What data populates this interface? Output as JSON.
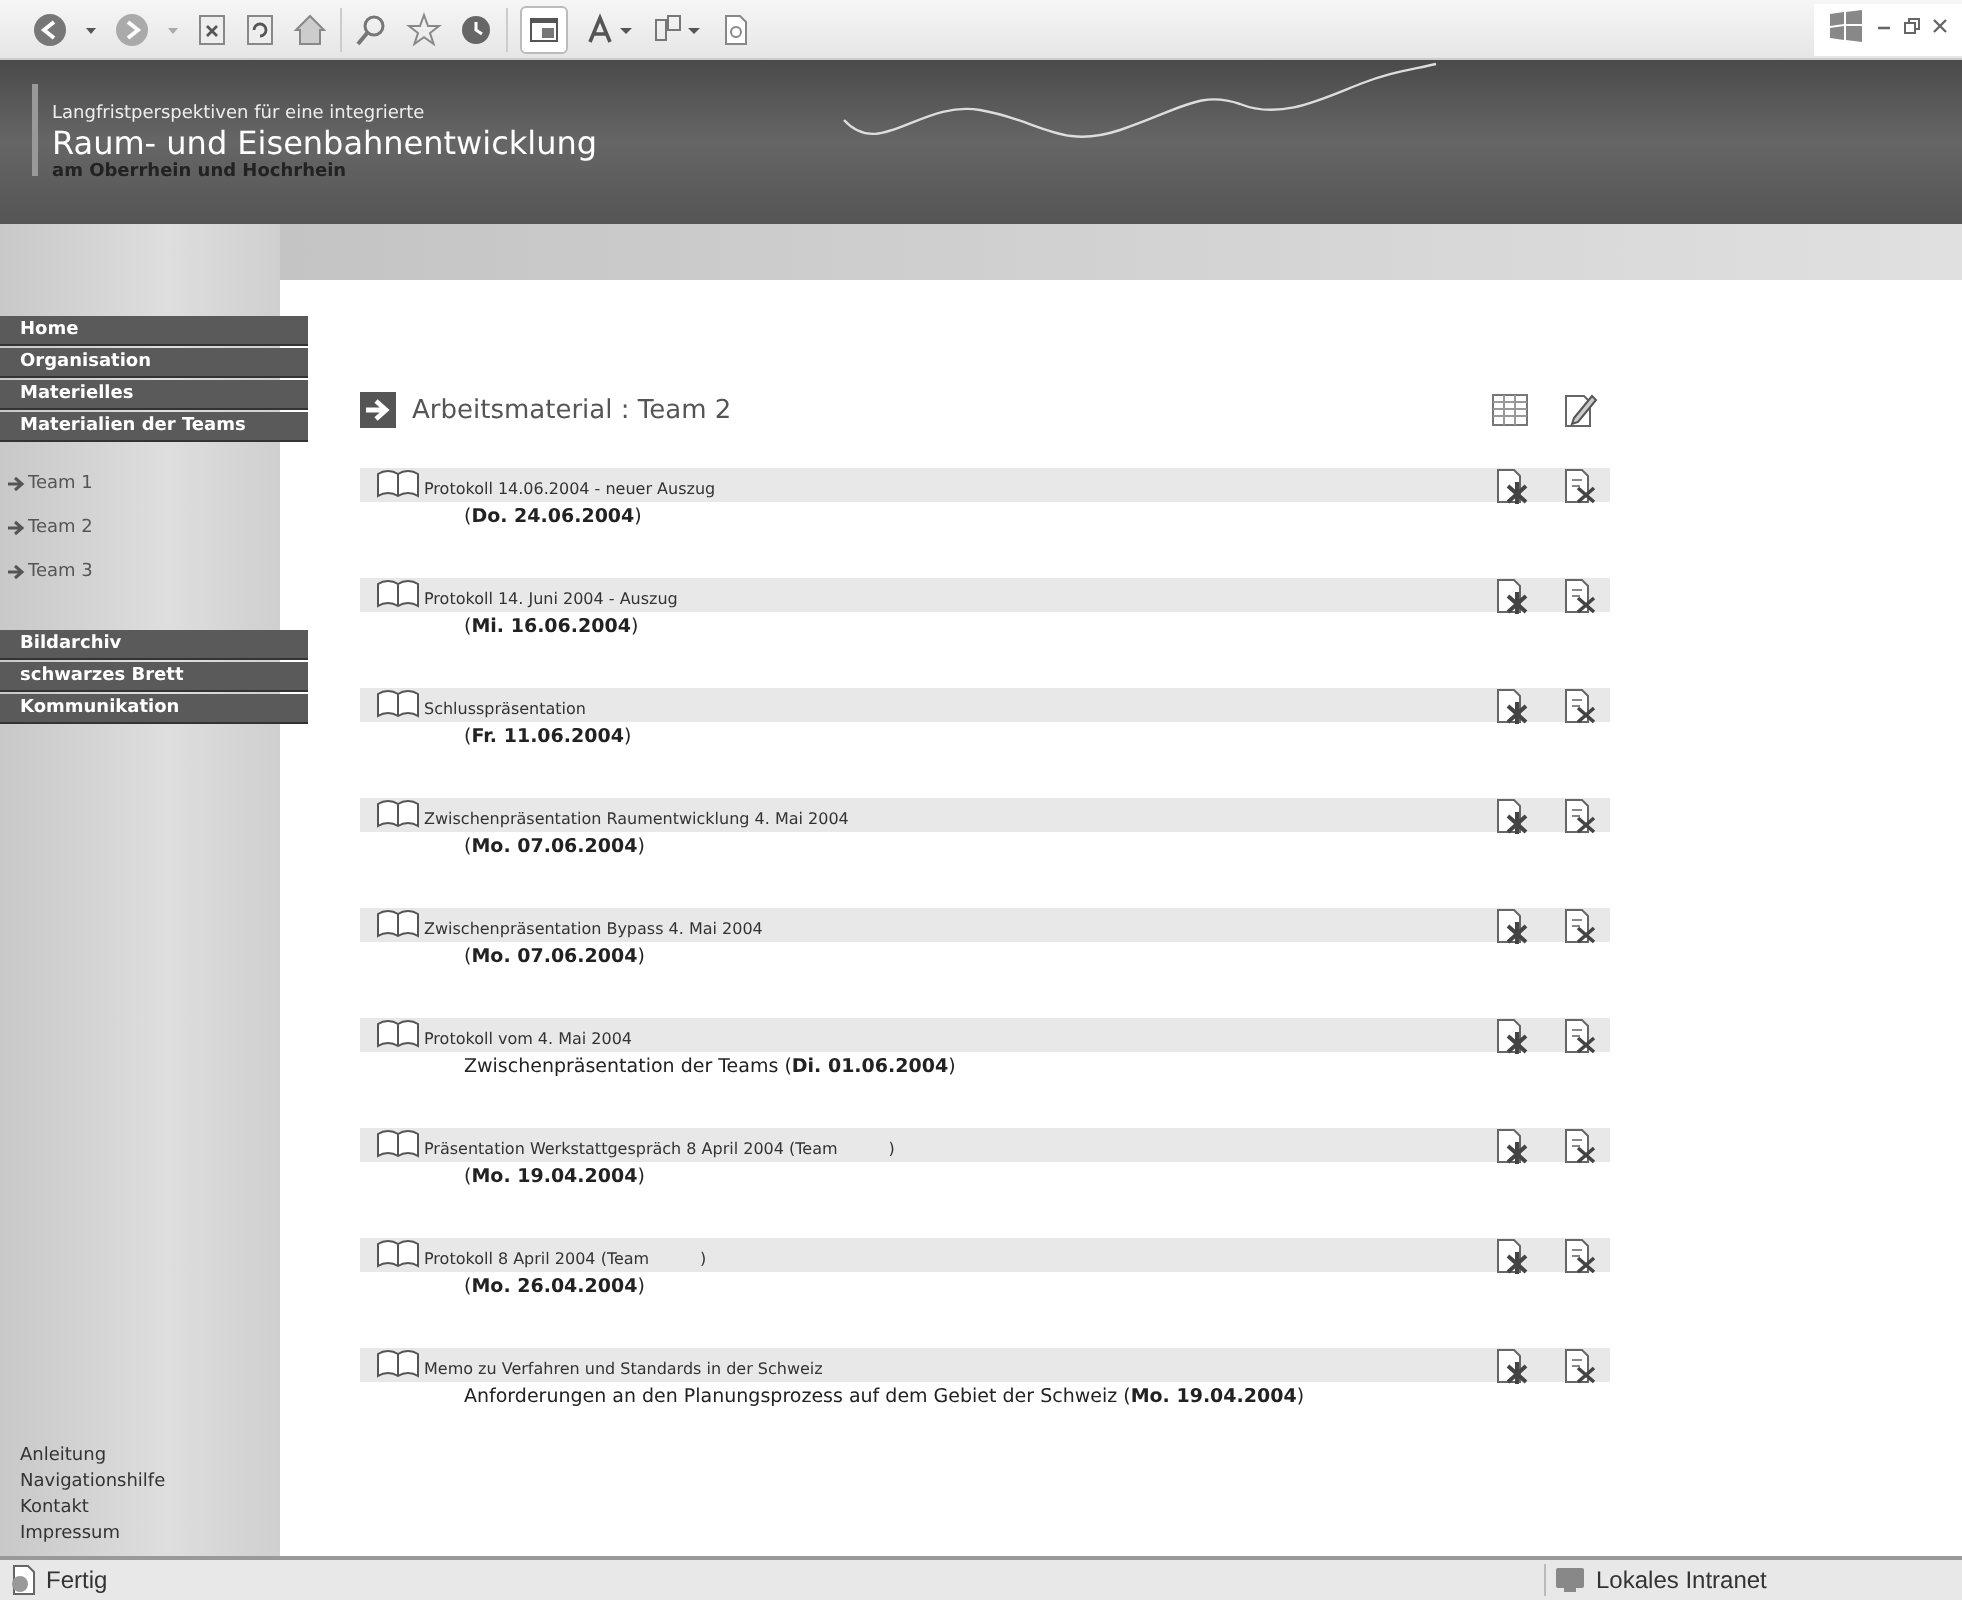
{
  "banner": {
    "kicker": "Langfristperspektiven für eine integrierte",
    "title": "Raum- und Eisenbahnentwicklung",
    "subtitle": "am Oberrhein und Hochrhein"
  },
  "sidebar": {
    "nav_top": [
      {
        "label": "Home"
      },
      {
        "label": "Organisation"
      },
      {
        "label": "Materielles"
      },
      {
        "label": "Materialien der Teams"
      }
    ],
    "sub_items": [
      {
        "label": "Team 1"
      },
      {
        "label": "Team 2"
      },
      {
        "label": "Team 3"
      }
    ],
    "nav_bottom": [
      {
        "label": "Bildarchiv"
      },
      {
        "label": "schwarzes Brett"
      },
      {
        "label": "Kommunikation"
      }
    ],
    "footer_links": [
      "Anleitung",
      "Navigationshilfe",
      "Kontakt",
      "Impressum"
    ]
  },
  "content": {
    "heading": "Arbeitsmaterial : Team 2",
    "items": [
      {
        "title": "Protokoll 14.06.2004 - neuer Auszug",
        "detail": "(**Do. 24.06.2004**)"
      },
      {
        "title": "Protokoll 14. Juni 2004 - Auszug",
        "detail": "(**Mi. 16.06.2004**)"
      },
      {
        "title": "Schlusspräsentation",
        "detail": "(**Fr. 11.06.2004**)"
      },
      {
        "title": "Zwischenpräsentation Raumentwicklung 4. Mai 2004",
        "detail": "(**Mo. 07.06.2004**)"
      },
      {
        "title": "Zwischenpräsentation Bypass 4. Mai 2004",
        "detail": "(**Mo. 07.06.2004**)"
      },
      {
        "title": "Protokoll vom 4. Mai 2004",
        "detail": "Zwischenpräsentation der Teams (**Di. 01.06.2004**)"
      },
      {
        "title": "Präsentation Werkstattgespräch 8 April 2004 (Team          )",
        "detail": "(**Mo. 19.04.2004**)"
      },
      {
        "title": "Protokoll 8 April 2004 (Team          )",
        "detail": "(**Mo. 26.04.2004**)"
      },
      {
        "title": "Memo zu Verfahren und Standards in der Schweiz",
        "detail": "Anforderungen an den Planungsprozess auf dem Gebiet der Schweiz (**Mo. 19.04.2004**)"
      }
    ]
  },
  "status_bar": {
    "status": "Fertig",
    "zone": "Lokales Intranet"
  }
}
